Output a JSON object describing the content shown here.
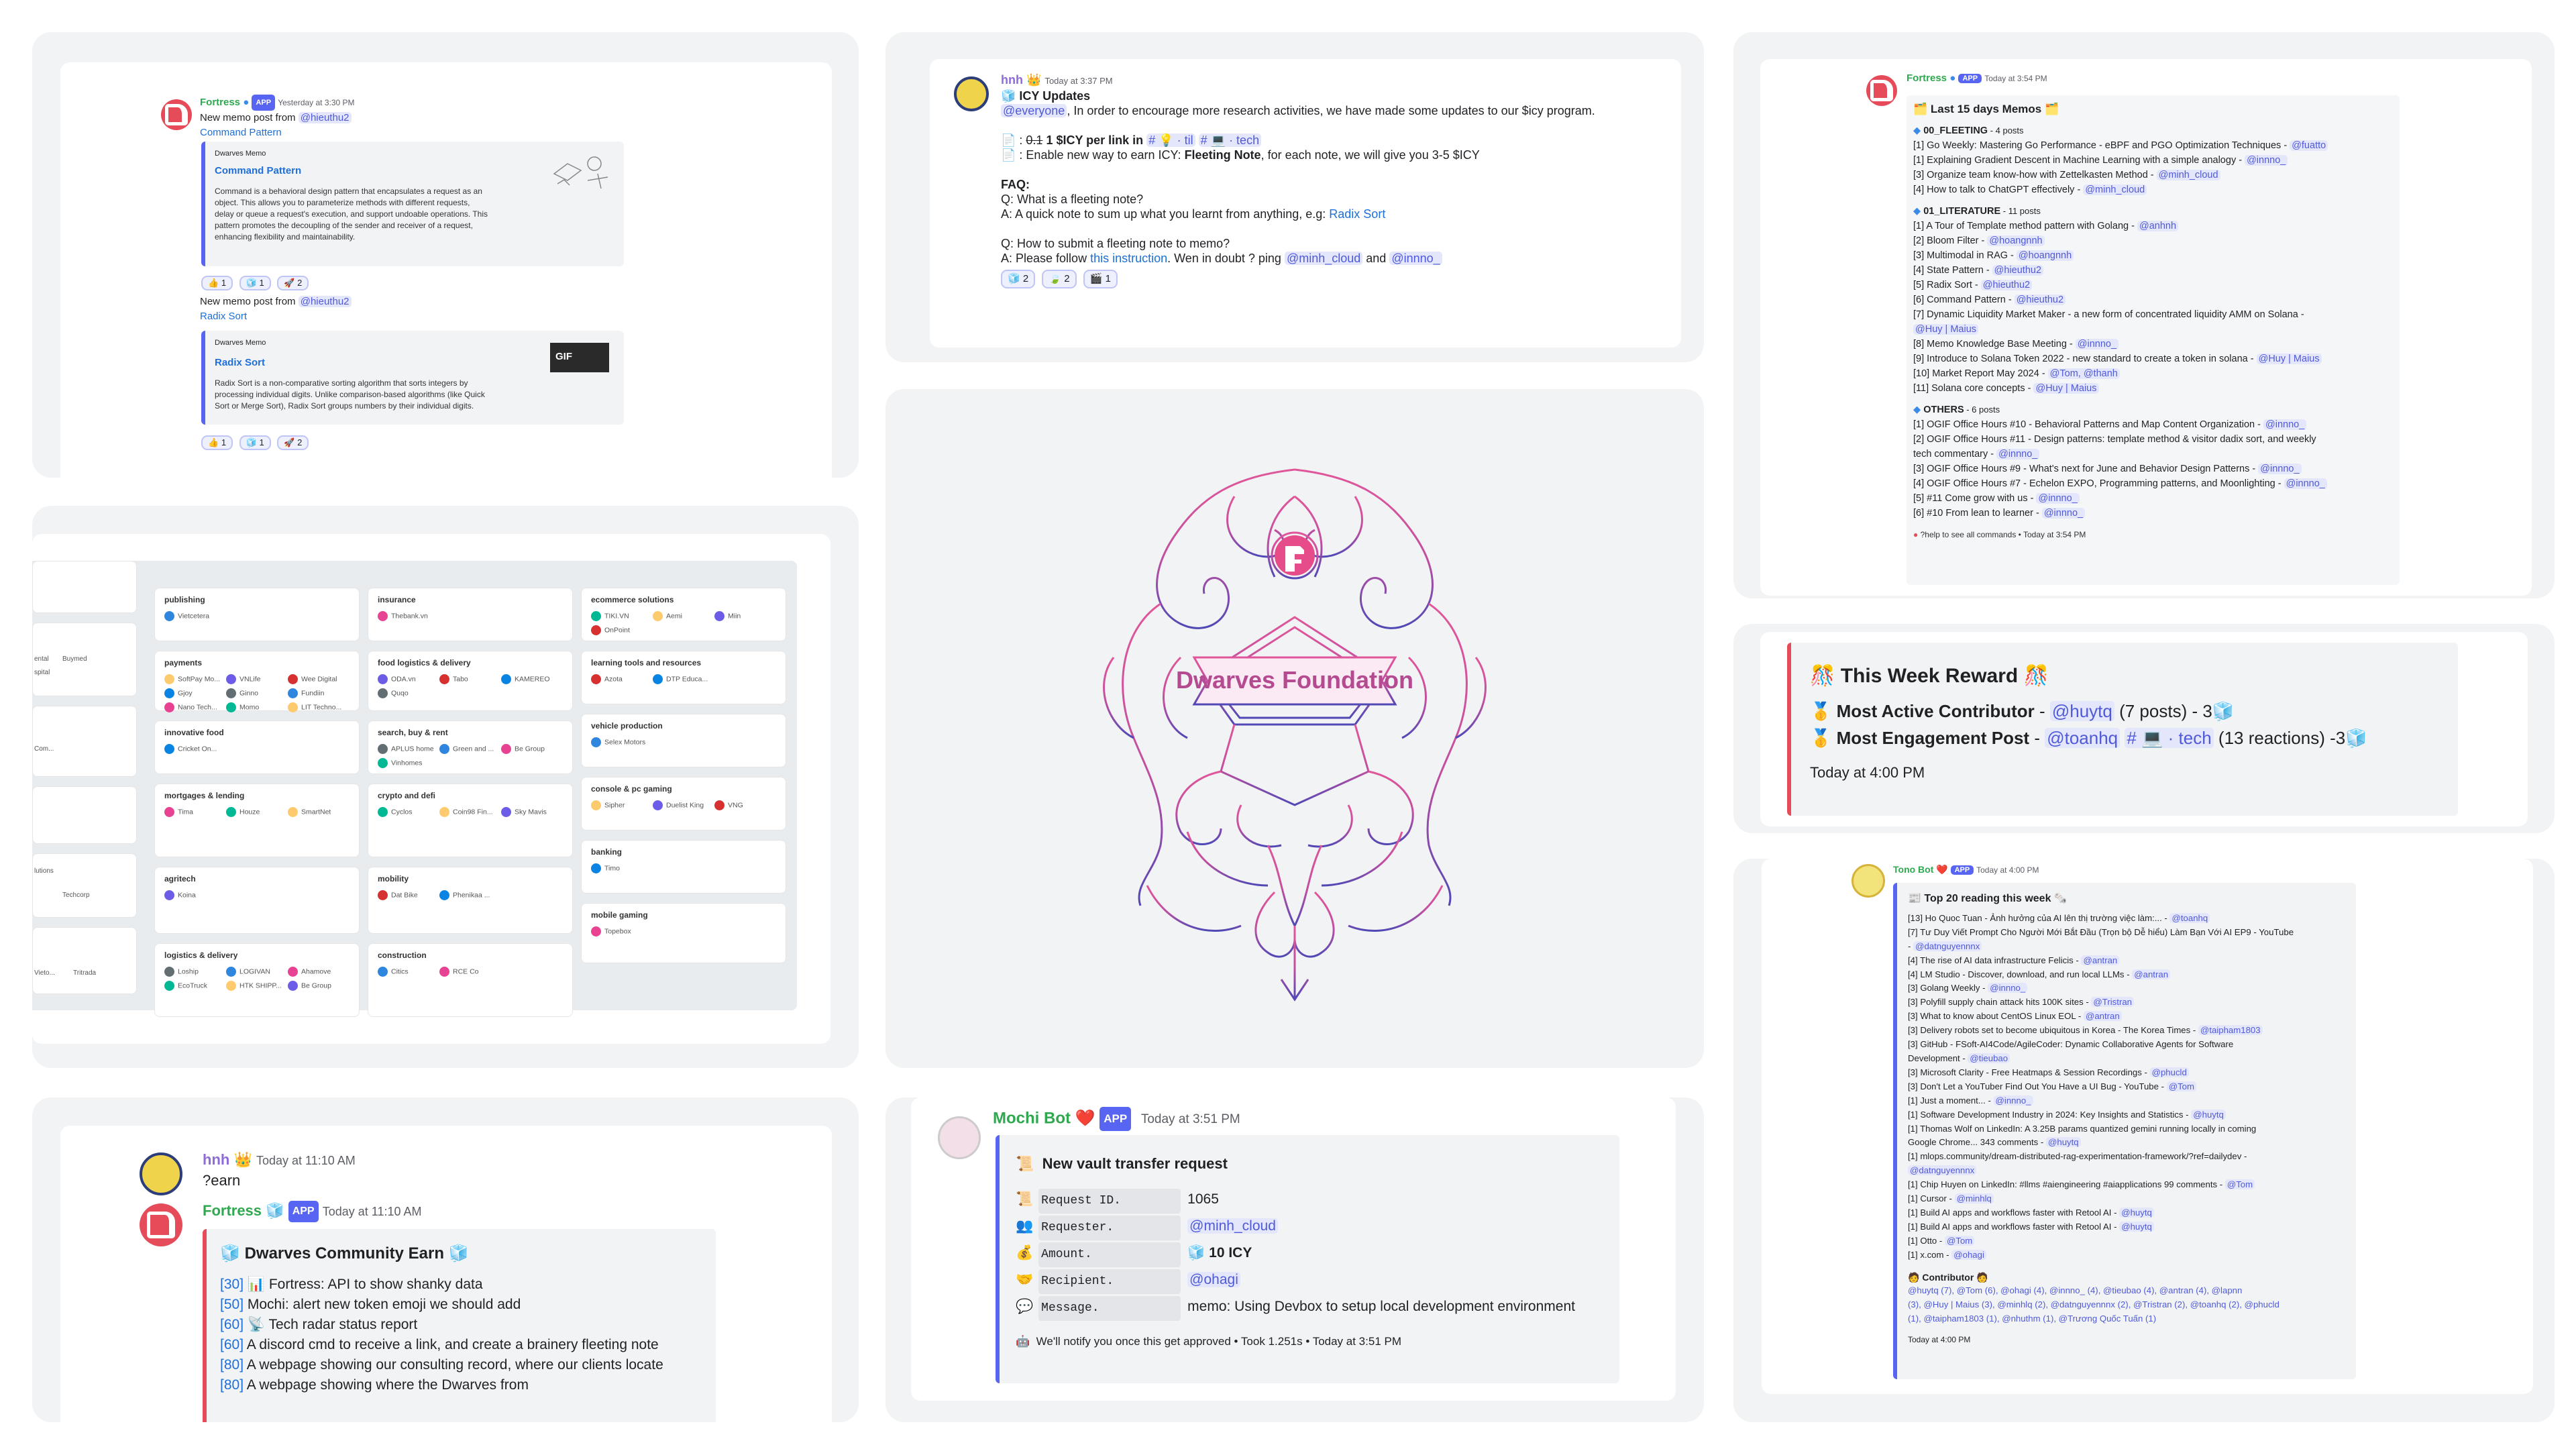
{
  "memo_panel": {
    "author": "Fortress",
    "app_badge": "APP",
    "time": "Yesterday at 3:30 PM",
    "post1": {
      "intro": "New memo post from",
      "mention": "@hieuthu2",
      "link": "Command Pattern",
      "embed_source": "Dwarves Memo",
      "embed_title": "Command Pattern",
      "embed_lines": [
        "Command is a behavioral design pattern that encapsulates a request as an",
        "object. This allows you to parameterize methods with different requests,",
        "delay or queue a request's execution, and support undoable operations. This",
        "pattern promotes the decoupling of the sender and receiver of a request,",
        "enhancing flexibility and maintainability."
      ],
      "reactions": [
        "1",
        "1",
        "2"
      ]
    },
    "post2": {
      "intro": "New memo post from",
      "mention": "@hieuthu2",
      "link": "Radix Sort",
      "embed_source": "Dwarves Memo",
      "embed_title": "Radix Sort",
      "gif_label": "GIF",
      "embed_lines": [
        "Radix Sort is a non-comparative sorting algorithm that sorts integers by",
        "processing individual digits. Unlike comparison-based algorithms (like Quick",
        "Sort or Merge Sort), Radix Sort groups numbers by their individual digits."
      ],
      "reactions": [
        "1",
        "1",
        "2"
      ]
    }
  },
  "icy_panel": {
    "author": "hnh",
    "time": "Today at 3:37 PM",
    "title": "ICY Updates",
    "mention_everyone": "@everyone",
    "intro": ", In order to encourage more research activities, we have made some updates to our $icy program.",
    "bullet1_strike": "0.1",
    "bullet1_rest": " 1 $ICY per link in",
    "bullet1_ch1": "# 💡 · til",
    "bullet1_ch2": "# 💻 · tech",
    "bullet2_pre": ": Enable new way to earn ICY: ",
    "bullet2_bold": "Fleeting Note",
    "bullet2_post": ", for each note, we will give you 3-5 $ICY",
    "faq": "FAQ:",
    "q1": "Q: What is a fleeting note?",
    "a1_pre": "A: A quick note to sum up what you learnt from anything, e.g: ",
    "a1_link": "Radix Sort",
    "q2": "Q: How to submit a fleeting note to memo?",
    "a2_pre": "A: Please follow ",
    "a2_link": "this instruction",
    "a2_mid": ". Wen in doubt ? ping ",
    "a2_m1": "@minh_cloud",
    "a2_and": " and ",
    "a2_m2": "@innno_",
    "reactions": [
      "2",
      "2",
      "1"
    ]
  },
  "logo_panel": {
    "name": "Dwarves Foundation"
  },
  "memos15_panel": {
    "author": "Fortress",
    "app_badge": "APP",
    "time": "Today at 3:54 PM",
    "title": "Last 15 days Memos",
    "sections": [
      {
        "name": "00_FLEETING",
        "count": "- 4 posts",
        "items": [
          [
            "[1] Go Weekly: Mastering Go Performance - eBPF and PGO Optimization Techniques - ",
            "@fuatto"
          ],
          [
            "[1] Explaining Gradient Descent in Machine Learning with a simple analogy - ",
            "@innno_"
          ],
          [
            "[3] Organize team know-how with Zettelkasten Method - ",
            "@minh_cloud"
          ],
          [
            "[4] How to talk to ChatGPT effectively - ",
            "@minh_cloud"
          ]
        ]
      },
      {
        "name": "01_LITERATURE",
        "count": "- 11 posts",
        "items": [
          [
            "[1] A Tour of Template method pattern with Golang - ",
            "@anhnh"
          ],
          [
            "[2] Bloom Filter - ",
            "@hoangnnh"
          ],
          [
            "[3] Multimodal in RAG - ",
            "@hoangnnh"
          ],
          [
            "[4] State Pattern - ",
            "@hieuthu2"
          ],
          [
            "[5] Radix Sort - ",
            "@hieuthu2"
          ],
          [
            "[6] Command Pattern - ",
            "@hieuthu2"
          ],
          [
            "[7] Dynamic Liquidity Market Maker - a new form of concentrated liquidity AMM on Solana - ",
            ""
          ],
          [
            "",
            "@Huy | Maius"
          ],
          [
            "[8] Memo Knowledge Base Meeting - ",
            "@innno_"
          ],
          [
            "[9] Introduce to Solana Token 2022 - new standard to create a token in solana - ",
            "@Huy | Maius"
          ],
          [
            "[10] Market Report May 2024 - ",
            "@Tom, @thanh"
          ],
          [
            "[11] Solana core concepts - ",
            "@Huy | Maius"
          ]
        ]
      },
      {
        "name": "OTHERS",
        "count": "- 6 posts",
        "items": [
          [
            "[1] OGIF Office Hours #10 - Behavioral Patterns and Map Content Organization - ",
            "@innno_"
          ],
          [
            "[2] OGIF Office Hours #11 - Design patterns: template method & visitor dadix sort, and weekly",
            ""
          ],
          [
            "tech commentary - ",
            "@innno_"
          ],
          [
            "[3] OGIF Office Hours #9 - What's next for June and Behavior Design Patterns - ",
            "@innno_"
          ],
          [
            "[4] OGIF Office Hours #7 - Echelon EXPO, Programming patterns, and Moonlighting - ",
            "@innno_"
          ],
          [
            "[5] #11 Come grow with us - ",
            "@innno_"
          ],
          [
            "[6] #10 From lean to learner - ",
            "@innno_"
          ]
        ]
      }
    ],
    "footer": "?help to see all commands • Today at 3:54 PM"
  },
  "reward_panel": {
    "title": "This Week Reward",
    "row1_label": "Most Active Contributor",
    "row1_mention": "@huytq",
    "row1_rest": "(7 posts) - 3",
    "row2_label": "Most Engagement Post",
    "row2_mention": "@toanhq",
    "row2_channel": "# 💻 · tech",
    "row2_rest": "(13 reactions) -3",
    "time": "Today at 4:00 PM"
  },
  "tono_panel": {
    "author": "Tono Bot",
    "app_badge": "APP",
    "time": "Today at 4:00 PM",
    "title": "Top 20 reading this week",
    "items": [
      [
        "[13] Ho Quoc Tuan - Ảnh hưởng của AI lên thị trường việc làm:... - ",
        "@toanhq"
      ],
      [
        "[7] Tư Duy Viết Prompt Cho Người Mới Bắt Đầu (Trọn bộ Dễ hiểu) Làm Bạn Với AI EP9 - YouTube",
        ""
      ],
      [
        "- ",
        "@datnguyennnx"
      ],
      [
        "[4] The rise of AI data infrastructure Felicis - ",
        "@antran"
      ],
      [
        "[4] LM Studio - Discover, download, and run local LLMs - ",
        "@antran"
      ],
      [
        "[3] Golang Weekly - ",
        "@innno_"
      ],
      [
        "[3] Polyfill supply chain attack hits 100K sites - ",
        "@Tristran"
      ],
      [
        "[3] What to know about CentOS Linux EOL - ",
        "@antran"
      ],
      [
        "[3] Delivery robots set to become ubiquitous in Korea - The Korea Times - ",
        "@taipham1803"
      ],
      [
        "[3] GitHub - FSoft-AI4Code/AgileCoder: Dynamic Collaborative Agents for Software",
        ""
      ],
      [
        "Development - ",
        "@tieubao"
      ],
      [
        "[3] Microsoft Clarity - Free Heatmaps & Session Recordings - ",
        "@phucld"
      ],
      [
        "[3] Don't Let a YouTuber Find Out You Have a UI Bug - YouTube - ",
        "@Tom"
      ],
      [
        "[1] Just a moment... - ",
        "@innno_"
      ],
      [
        "[1] Software Development Industry in 2024: Key Insights and Statistics - ",
        "@huytq"
      ],
      [
        "[1] Thomas Wolf on LinkedIn: A 3.25B params quantized gemini running locally in coming",
        ""
      ],
      [
        "Google Chrome... 343 comments - ",
        "@huytq"
      ],
      [
        "[1] mlops.community/dream-distributed-rag-experimentation-framework/?ref=dailydev - ",
        ""
      ],
      [
        "",
        "@datnguyennnx"
      ],
      [
        "[1] Chip Huyen on LinkedIn: #llms #aiengineering #aiapplications 99 comments - ",
        "@Tom"
      ],
      [
        "[1] Cursor - ",
        "@minhlq"
      ],
      [
        "[1] Build AI apps and workflows faster with Retool AI - ",
        "@huytq"
      ],
      [
        "[1] Build AI apps and workflows faster with Retool AI - ",
        "@huytq"
      ],
      [
        "[1] Otto - ",
        "@Tom"
      ],
      [
        "[1] x.com - ",
        "@ohagi"
      ]
    ],
    "contributor_title": "Contributor",
    "contributor_lines": [
      "@huytq (7), @Tom (6), @ohagi (4), @innno_ (4), @tieubao (4), @antran (4), @lapnn",
      "(3), @Huy | Maius (3), @minhlq (2), @datnguyennnx (2), @Tristran (2), @toanhq (2), @phucld",
      "(1), @taipham1803 (1), @nhuthm (1), @Trương Quốc Tuấn (1)"
    ],
    "footer_time": "Today at 4:00 PM"
  },
  "earn_panel": {
    "user": "hnh",
    "user_time": "Today at 11:10 AM",
    "command": "?earn",
    "bot": "Fortress",
    "app_badge": "APP",
    "bot_time": "Today at 11:10 AM",
    "embed_title": "Dwarves Community Earn",
    "items": [
      [
        "[30]",
        "📊 Fortress: API to show shanky data"
      ],
      [
        "[50]",
        "Mochi: alert new token emoji we should add"
      ],
      [
        "[60]",
        "📡 Tech radar status report"
      ],
      [
        "[60]",
        "A discord cmd to receive a link, and create a brainery fleeting note"
      ],
      [
        "[80]",
        "A webpage showing our consulting record, where our clients locate"
      ],
      [
        "[80]",
        "A webpage showing where the Dwarves from"
      ]
    ]
  },
  "vault_panel": {
    "author": "Mochi Bot",
    "app_badge": "APP",
    "time": "Today at 3:51 PM",
    "title": "New vault transfer request",
    "fields": [
      {
        "label": "Request ID.",
        "value": "1065",
        "icon": "scroll-icon"
      },
      {
        "label": "Requester.",
        "value": "@minh_cloud",
        "icon": "people-icon"
      },
      {
        "label": "Amount.",
        "value": "10 ICY",
        "icon": "money-icon"
      },
      {
        "label": "Recipient.",
        "value": "@ohagi",
        "icon": "handshake-icon"
      },
      {
        "label": "Message.",
        "value": "memo: Using Devbox to setup local development environment",
        "icon": "chat-icon"
      }
    ],
    "footer": "We'll notify you once this get approved • Took 1.251s • Today at 3:51 PM"
  },
  "landscape_panel": {
    "categories": [
      {
        "title": "publishing",
        "companies": [
          "Vietcetera"
        ]
      },
      {
        "title": "insurance",
        "companies": [
          "Thebank.vn"
        ]
      },
      {
        "title": "ecommerce solutions",
        "companies": [
          "TIKI.VN",
          "Aemi",
          "Miin",
          "OnPoint"
        ]
      },
      {
        "title": "payments",
        "companies": [
          "SoftPay Mo...",
          "VNLife",
          "Wee Digital",
          "Gjoy",
          "Ginno",
          "Fundiin",
          "Nano Tech...",
          "Momo",
          "LIT Techno..."
        ]
      },
      {
        "title": "food logistics & delivery",
        "companies": [
          "ODA.vn",
          "Tabo",
          "KAMEREO",
          "Quqo"
        ]
      },
      {
        "title": "learning tools and resources",
        "companies": [
          "Azota",
          "DTP Educa..."
        ]
      },
      {
        "title": "innovative food",
        "companies": [
          "Cricket On..."
        ]
      },
      {
        "title": "search, buy & rent",
        "companies": [
          "APLUS home",
          "Green and ...",
          "Be Group",
          "Vinhomes"
        ]
      },
      {
        "title": "vehicle production",
        "companies": [
          "Selex Motors"
        ]
      },
      {
        "title": "mortgages & lending",
        "companies": [
          "Tima",
          "Houze",
          "SmartNet"
        ]
      },
      {
        "title": "crypto and defi",
        "companies": [
          "Cyclos",
          "Coin98 Fin...",
          "Sky Mavis"
        ]
      },
      {
        "title": "console & pc gaming",
        "companies": [
          "Sipher",
          "Duelist King",
          "VNG"
        ]
      },
      {
        "title": "agritech",
        "companies": [
          "Koina"
        ]
      },
      {
        "title": "mobility",
        "companies": [
          "Dat Bike",
          "Phenikaa ..."
        ]
      },
      {
        "title": "banking",
        "companies": [
          "Timo"
        ]
      },
      {
        "title": "logistics & delivery",
        "companies": [
          "Loship",
          "LOGIVAN",
          "Ahamove",
          "EcoTruck",
          "HTK SHIPP...",
          "Be Group"
        ]
      },
      {
        "title": "construction",
        "companies": [
          "Citics",
          "RCE Co"
        ]
      },
      {
        "title": "mobile gaming",
        "companies": [
          "Topebox"
        ]
      }
    ],
    "left_fragments": [
      "ental",
      "Buymed",
      "spital",
      "Com...",
      "lutions",
      "Techcorp",
      "Vieto...",
      "Tritrada"
    ]
  }
}
